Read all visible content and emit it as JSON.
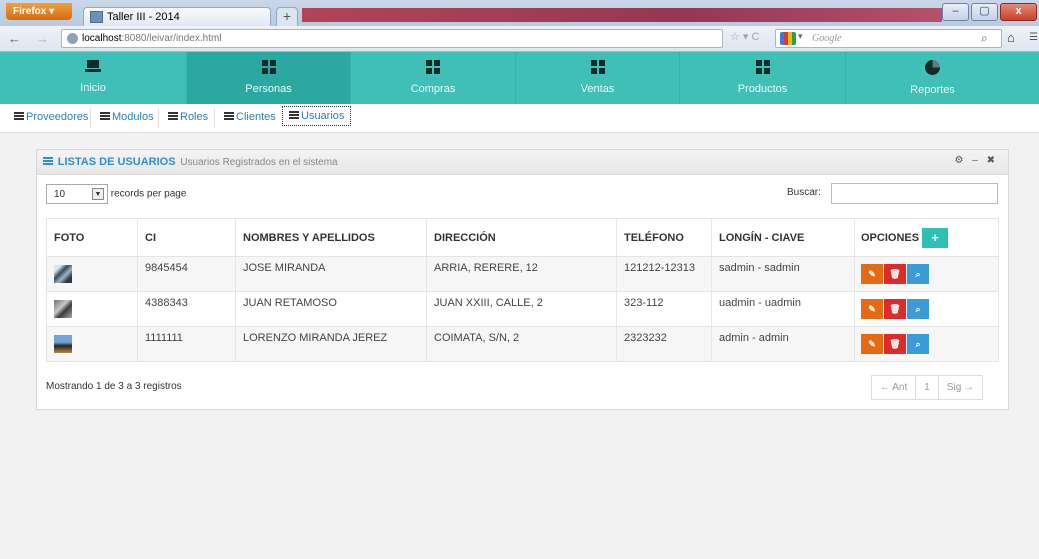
{
  "browser": {
    "menu_button": "Firefox",
    "tab_title": "Taller III - 2014",
    "new_tab": "+",
    "window_title_obscured": "",
    "url_host": "localhost",
    "url_rest": ":8080/leivar/index.html",
    "search_engine": "Google",
    "controls": {
      "minimize": "–",
      "maximize": "▢",
      "close": "x"
    }
  },
  "topmenu": [
    {
      "label": "Inicio",
      "icon": "laptop-icon"
    },
    {
      "label": "Personas",
      "icon": "grid-icon",
      "active": true
    },
    {
      "label": "Compras",
      "icon": "grid-icon"
    },
    {
      "label": "Ventas",
      "icon": "grid-icon"
    },
    {
      "label": "Productos",
      "icon": "grid-icon"
    },
    {
      "label": "Reportes",
      "icon": "pie-chart-icon"
    }
  ],
  "submenu": [
    {
      "label": "Proveedores"
    },
    {
      "label": "Modulos"
    },
    {
      "label": "Roles"
    },
    {
      "label": "Clientes"
    },
    {
      "label": "Usuarios",
      "active": true
    }
  ],
  "panel": {
    "title": "LISTAS DE USUARIOS",
    "subtitle": "Usuarios Registrados en el sistema",
    "icons": [
      "gear-icon",
      "minimize-icon",
      "close-icon"
    ]
  },
  "controls": {
    "page_size": "10",
    "page_size_label": "records per page",
    "search_label": "Buscar:",
    "search_value": ""
  },
  "table": {
    "headers": [
      "FOTO",
      "CI",
      "NOMBRES Y APELLIDOS",
      "DIRECCIÓN",
      "TELÉFONO",
      "LONGÍN - CIAVE",
      "OPCIONES"
    ],
    "add_button": "+",
    "rows": [
      {
        "ci": "9845454",
        "name": "JOSE MIRANDA",
        "address": "ARRIA, RERERE, 12",
        "phone": "121212-12313",
        "login": "sadmin - sadmin"
      },
      {
        "ci": "4388343",
        "name": "JUAN RETAMOSO",
        "address": "JUAN XXIII, CALLE, 2",
        "phone": "323-112",
        "login": "uadmin - uadmin"
      },
      {
        "ci": "1111111",
        "name": "LORENZO MIRANDA JEREZ",
        "address": "COIMATA, S/N, 2",
        "phone": "2323232",
        "login": "admin - admin"
      }
    ]
  },
  "footer": {
    "info": "Mostrando 1 de 3 a 3 registros",
    "prev": "← Ant",
    "page": "1",
    "next": "Sig →"
  },
  "colors": {
    "menu_bg": "#3fbfb6",
    "menu_active": "#2ba89f",
    "edit": "#e66a14",
    "delete": "#dc2b2b",
    "view": "#3b9ad8"
  }
}
